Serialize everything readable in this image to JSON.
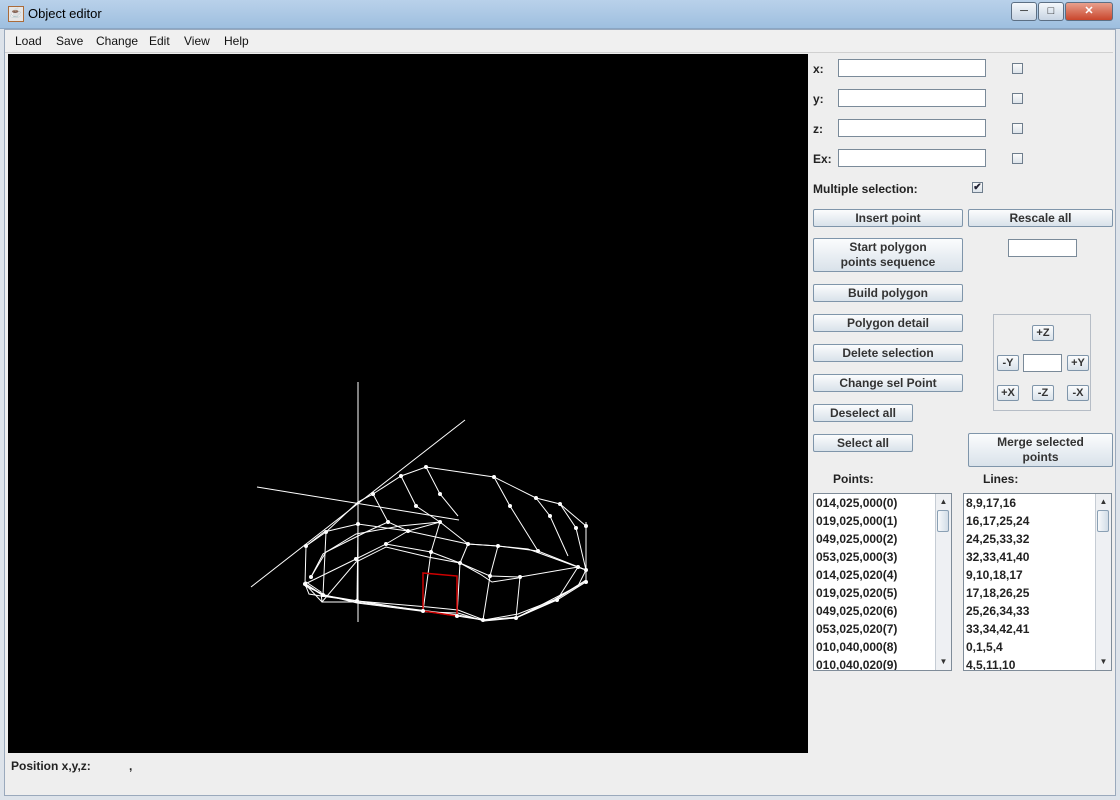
{
  "window": {
    "title": "Object editor",
    "minimize": "─",
    "maximize": "□",
    "close": "✕",
    "app_icon": "java-cup-icon"
  },
  "menu": [
    "Load",
    "Save",
    "Change",
    "Edit",
    "View",
    "Help"
  ],
  "coords": {
    "x_label": "x:",
    "x_value": "",
    "y_label": "y:",
    "y_value": "",
    "z_label": "z:",
    "z_value": "",
    "ex_label": "Ex:",
    "ex_value": ""
  },
  "multiple_selection": {
    "label": "Multiple selection:",
    "checked": true,
    "mark": "✔"
  },
  "buttons": {
    "insert_point": "Insert point",
    "rescale_all": "Rescale all",
    "start_polygon_line1": "Start polygon",
    "start_polygon_line2": "points sequence",
    "build_polygon": "Build polygon",
    "polygon_detail": "Polygon detail",
    "delete_selection": "Delete selection",
    "change_sel_point": "Change sel Point",
    "deselect_all": "Deselect all",
    "select_all": "Select all",
    "merge_line1": "Merge selected",
    "merge_line2": "points"
  },
  "rescale_value": "",
  "axis": {
    "plus_z": "+Z",
    "minus_y": "-Y",
    "plus_y": "+Y",
    "plus_x": "+X",
    "minus_z": "-Z",
    "minus_x": "-X",
    "step_value": ""
  },
  "points": {
    "label": "Points:",
    "items": [
      "014,025,000(0)",
      "019,025,000(1)",
      "049,025,000(2)",
      "053,025,000(3)",
      "014,025,020(4)",
      "019,025,020(5)",
      "049,025,020(6)",
      "053,025,020(7)",
      "010,040,000(8)",
      "010,040,020(9)"
    ]
  },
  "lines": {
    "label": "Lines:",
    "items": [
      "8,9,17,16",
      "16,17,25,24",
      "24,25,33,32",
      "32,33,41,40",
      "9,10,18,17",
      "17,18,26,25",
      "25,26,34,33",
      "33,34,42,41",
      "0,1,5,4",
      "4,5,11,10"
    ]
  },
  "status": {
    "label": "Position x,y,z:",
    "value": ","
  },
  "colors": {
    "canvas": "#000000",
    "wire": "#ffffff",
    "selected": "#d00000"
  },
  "scroll": {
    "up": "▲",
    "down": "▼"
  }
}
